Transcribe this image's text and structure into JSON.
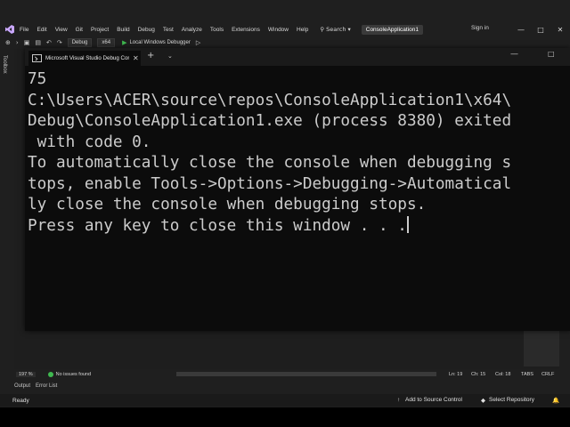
{
  "menubar": {
    "items": [
      "File",
      "Edit",
      "View",
      "Git",
      "Project",
      "Build",
      "Debug",
      "Test",
      "Analyze",
      "Tools",
      "Extensions",
      "Window",
      "Help"
    ],
    "search_label": "Search",
    "solution_name": "ConsoleApplication1",
    "signin_label": "Sign in"
  },
  "toolbar": {
    "config": "Debug",
    "platform": "x64",
    "run_label": "Local Windows Debugger"
  },
  "toolbox": {
    "label": "Toolbox"
  },
  "console": {
    "tab_title": "Microsoft Visual Studio Debug Console",
    "lines": [
      "75",
      "C:\\Users\\ACER\\source\\repos\\ConsoleApplication1\\x64\\",
      "Debug\\ConsoleApplication1.exe (process 8380) exited",
      " with code 0.",
      "To automatically close the console when debugging s",
      "tops, enable Tools->Options->Debugging->Automatical",
      "ly close the console when debugging stops.",
      "Press any key to close this window . . ."
    ]
  },
  "editor_status": {
    "zoom": "197 %",
    "issues": "No issues found",
    "ln": "Ln: 19",
    "ch": "Ch: 15",
    "col": "Col: 18",
    "tabs": "TABS",
    "eol": "CRLF"
  },
  "panel": {
    "tabs": [
      "Output",
      "Error List"
    ]
  },
  "statusbar": {
    "ready": "Ready",
    "source_control": "Add to Source Control",
    "repository": "Select Repository"
  },
  "colors": {
    "console_bg": "#0c0c0c",
    "console_text": "#cccccc",
    "ide_bg": "#1f1f1f",
    "run_green": "#3fb950"
  }
}
